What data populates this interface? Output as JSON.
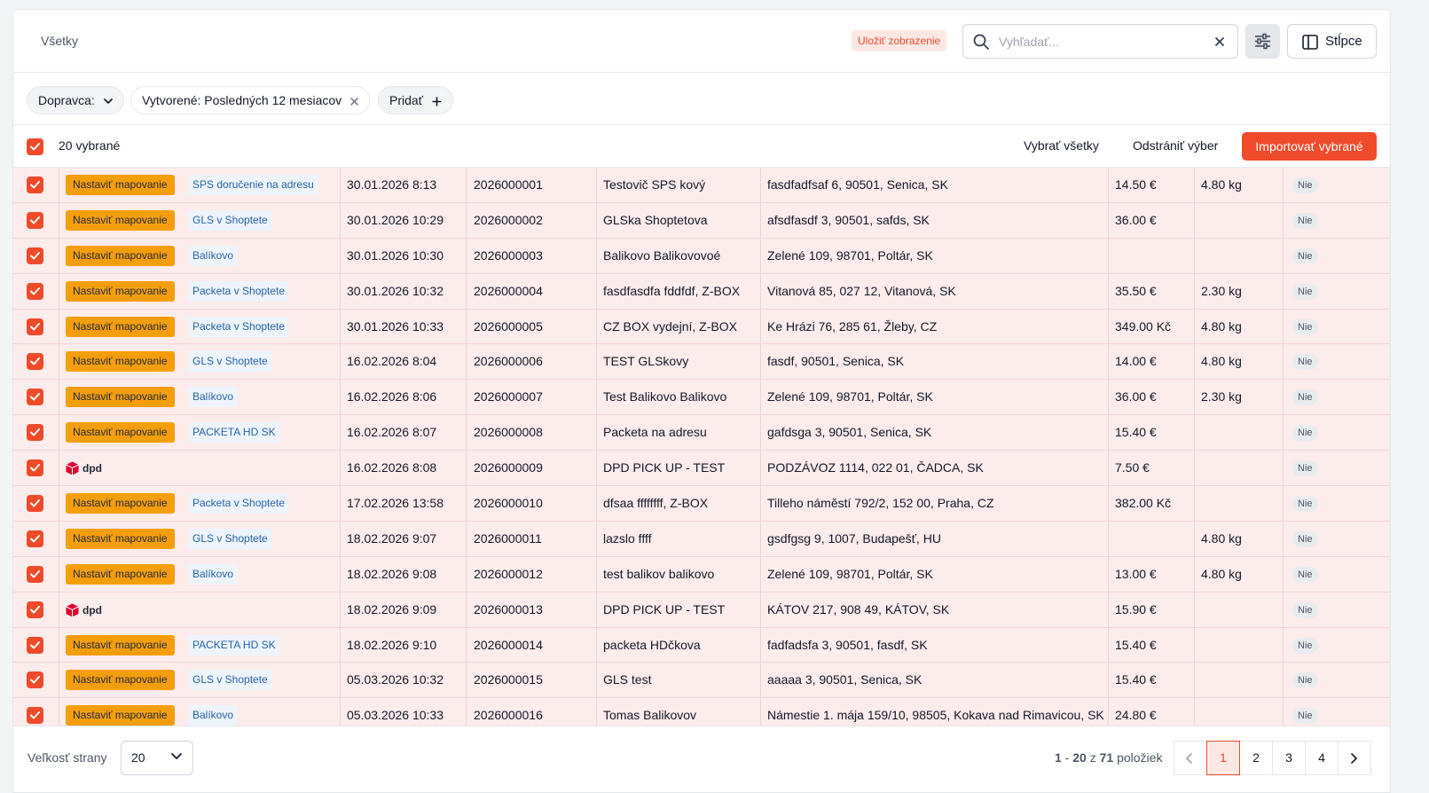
{
  "topbar": {
    "tab_label": "Všetky",
    "save_view_label": "Uložiť zobrazenie",
    "search_placeholder": "Vyhľadať...",
    "columns_label": "Stĺpce"
  },
  "filters": {
    "carrier_label": "Dopravca:",
    "created_label": "Vytvorené: Posledných 12 mesiacov",
    "add_label": "Pridať"
  },
  "selection": {
    "count_label": "20 vybrané",
    "select_all_label": "Vybrať všetky",
    "clear_label": "Odstrániť výber",
    "import_label": "Importovať vybrané"
  },
  "mapping_label": "Nastaviť mapovanie",
  "rows": [
    {
      "carrier": "SPS doručenie na adresu",
      "date": "30.01.2026 8:13",
      "number": "2026000001",
      "name": "Testovič SPS kový",
      "address": "fasdfadfsaf 6, 90501, Senica, SK",
      "price": "14.50 €",
      "weight": "4.80 kg",
      "status": "Nie"
    },
    {
      "carrier": "GLS v Shoptete",
      "date": "30.01.2026 10:29",
      "number": "2026000002",
      "name": "GLSka Shoptetova",
      "address": "afsdfasdf 3, 90501, safds, SK",
      "price": "36.00 €",
      "weight": "",
      "status": "Nie"
    },
    {
      "carrier": "Balíkovo",
      "date": "30.01.2026 10:30",
      "number": "2026000003",
      "name": "Balikovo Balikovovoé",
      "address": "Zelené 109, 98701, Poltár, SK",
      "price": "",
      "weight": "",
      "status": "Nie"
    },
    {
      "carrier": "Packeta v Shoptete",
      "date": "30.01.2026 10:32",
      "number": "2026000004",
      "name": "fasdfasdfa fddfdf, Z-BOX",
      "address": "Vitanová 85, 027 12, Vitanová, SK",
      "price": "35.50 €",
      "weight": "2.30 kg",
      "status": "Nie"
    },
    {
      "carrier": "Packeta v Shoptete",
      "date": "30.01.2026 10:33",
      "number": "2026000005",
      "name": "CZ BOX vydejní, Z-BOX",
      "address": "Ke Hrázi 76, 285 61, Žleby, CZ",
      "price": "349.00 Kč",
      "weight": "4.80 kg",
      "status": "Nie"
    },
    {
      "carrier": "GLS v Shoptete",
      "date": "16.02.2026 8:04",
      "number": "2026000006",
      "name": "TEST GLSkovy",
      "address": "fasdf, 90501, Senica, SK",
      "price": "14.00 €",
      "weight": "4.80 kg",
      "status": "Nie"
    },
    {
      "carrier": "Balíkovo",
      "date": "16.02.2026 8:06",
      "number": "2026000007",
      "name": "Test Balikovo Balikovo",
      "address": "Zelené 109, 98701, Poltár, SK",
      "price": "36.00 €",
      "weight": "2.30 kg",
      "status": "Nie"
    },
    {
      "carrier": "PACKETA HD SK",
      "date": "16.02.2026 8:07",
      "number": "2026000008",
      "name": "Packeta na adresu",
      "address": "gafdsga 3, 90501, Senica, SK",
      "price": "15.40 €",
      "weight": "",
      "status": "Nie"
    },
    {
      "carrier": "dpd",
      "date": "16.02.2026 8:08",
      "number": "2026000009",
      "name": "DPD PICK UP - TEST",
      "address": "PODZÁVOZ 1114, 022 01, ČADCA, SK",
      "price": "7.50 €",
      "weight": "",
      "status": "Nie"
    },
    {
      "carrier": "Packeta v Shoptete",
      "date": "17.02.2026 13:58",
      "number": "2026000010",
      "name": "dfsaa ffffffff, Z-BOX",
      "address": "Tilleho náměstí 792/2, 152 00, Praha, CZ",
      "price": "382.00 Kč",
      "weight": "",
      "status": "Nie"
    },
    {
      "carrier": "GLS v Shoptete",
      "date": "18.02.2026 9:07",
      "number": "2026000011",
      "name": "lazslo ffff",
      "address": "gsdfgsg 9, 1007, Budapešť, HU",
      "price": "",
      "weight": "4.80 kg",
      "status": "Nie"
    },
    {
      "carrier": "Balíkovo",
      "date": "18.02.2026 9:08",
      "number": "2026000012",
      "name": "test balikov balikovo",
      "address": "Zelené 109, 98701, Poltár, SK",
      "price": "13.00 €",
      "weight": "4.80 kg",
      "status": "Nie"
    },
    {
      "carrier": "dpd",
      "date": "18.02.2026 9:09",
      "number": "2026000013",
      "name": "DPD PICK UP - TEST",
      "address": "KÁTOV 217, 908 49, KÁTOV, SK",
      "price": "15.90 €",
      "weight": "",
      "status": "Nie"
    },
    {
      "carrier": "PACKETA HD SK",
      "date": "18.02.2026 9:10",
      "number": "2026000014",
      "name": "packeta HDčkova",
      "address": "fadfadsfa 3, 90501, fasdf, SK",
      "price": "15.40 €",
      "weight": "",
      "status": "Nie"
    },
    {
      "carrier": "GLS v Shoptete",
      "date": "05.03.2026 10:32",
      "number": "2026000015",
      "name": "GLS test",
      "address": "aaaaa 3, 90501, Senica, SK",
      "price": "15.40 €",
      "weight": "",
      "status": "Nie"
    },
    {
      "carrier": "Balíkovo",
      "date": "05.03.2026 10:33",
      "number": "2026000016",
      "name": "Tomas Balikovov",
      "address": "Námestie 1. mája 159/10, 98505, Kokava nad Rimavicou, SK",
      "price": "24.80 €",
      "weight": "",
      "status": "Nie"
    }
  ],
  "footer": {
    "page_size_label": "Veľkosť strany",
    "page_size_value": "20",
    "range_from": "1",
    "range_to": "20",
    "range_of": "z",
    "range_total": "71",
    "range_suffix": "položiek",
    "pages": [
      "1",
      "2",
      "3",
      "4"
    ],
    "current_page": "1"
  },
  "colors": {
    "accent": "#ef4a2a",
    "mapping_badge": "#f59e0b",
    "row_selected_bg": "#fdecec",
    "carrier_badge_text": "#2563a8"
  }
}
